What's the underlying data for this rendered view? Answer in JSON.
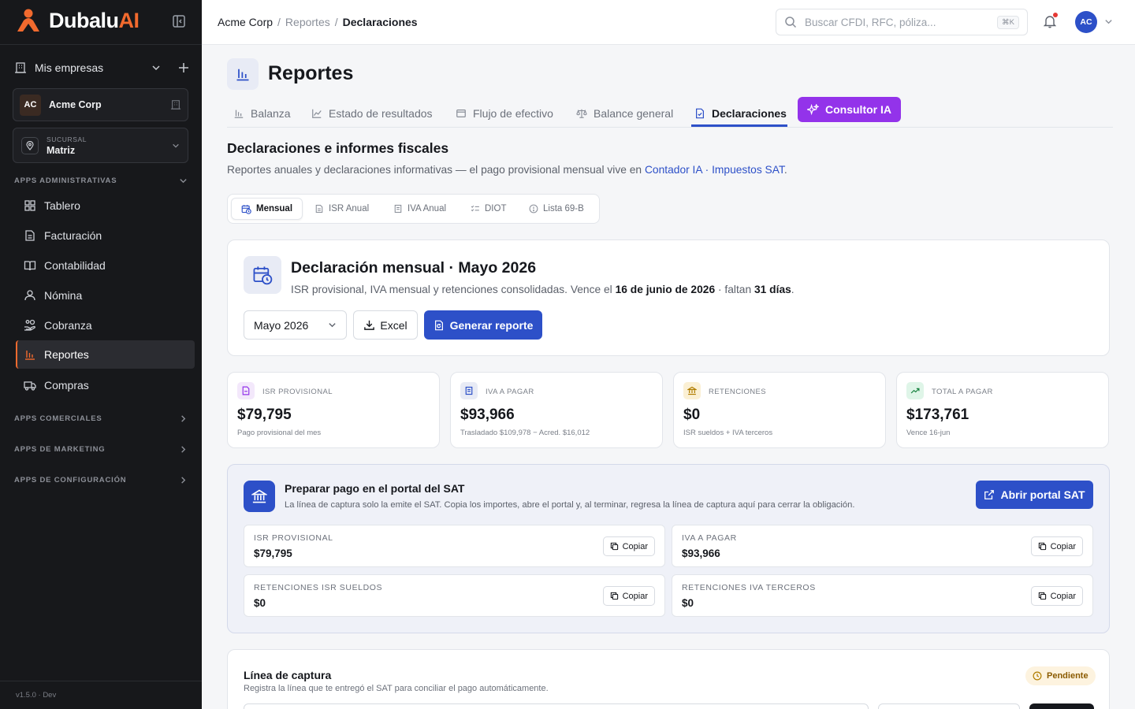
{
  "brand": {
    "name_primary": "Dubalu",
    "name_accent": "AI"
  },
  "sidebar": {
    "mis_empresas": "Mis empresas",
    "company": {
      "initials": "AC",
      "name": "Acme Corp"
    },
    "sucursal": {
      "label": "SUCURSAL",
      "value": "Matriz"
    },
    "sections": {
      "admin": "APPS ADMINISTRATIVAS",
      "comerciales": "APPS COMERCIALES",
      "marketing": "APPS DE MARKETING",
      "config": "APPS DE CONFIGURACIÓN"
    },
    "items": [
      {
        "label": "Tablero"
      },
      {
        "label": "Facturación"
      },
      {
        "label": "Contabilidad"
      },
      {
        "label": "Nómina"
      },
      {
        "label": "Cobranza"
      },
      {
        "label": "Reportes"
      },
      {
        "label": "Compras"
      }
    ],
    "version": "v1.5.0 · Dev"
  },
  "topbar": {
    "breadcrumb": [
      "Acme Corp",
      "Reportes",
      "Declaraciones"
    ],
    "search_placeholder": "Buscar CFDI, RFC, póliza...",
    "search_shortcut": "⌘K",
    "user_initials": "AC"
  },
  "page": {
    "title": "Reportes",
    "tabs": [
      {
        "label": "Balanza"
      },
      {
        "label": "Estado de resultados"
      },
      {
        "label": "Flujo de efectivo"
      },
      {
        "label": "Balance general"
      },
      {
        "label": "Declaraciones"
      },
      {
        "label": "Consultor IA"
      }
    ],
    "section_title": "Declaraciones e informes fiscales",
    "section_sub_pre": "Reportes anuales y declaraciones informativas — el pago provisional mensual vive en",
    "section_sub_link": "Contador IA · Impuestos SAT",
    "section_sub_post": ".",
    "subtabs": [
      {
        "label": "Mensual"
      },
      {
        "label": "ISR Anual"
      },
      {
        "label": "IVA Anual"
      },
      {
        "label": "DIOT"
      },
      {
        "label": "Lista 69-B"
      }
    ]
  },
  "declaracion": {
    "title": "Declaración mensual · Mayo 2026",
    "sub_pre": "ISR provisional, IVA mensual y retenciones consolidadas. Vence el",
    "due_date": "16 de junio de 2026",
    "sub_mid": "· faltan",
    "days_left": "31 días",
    "sub_end": ".",
    "period": "Mayo 2026",
    "excel_label": "Excel",
    "generate_label": "Generar reporte"
  },
  "stats": [
    {
      "label": "ISR PROVISIONAL",
      "value": "$79,795",
      "sub": "Pago provisional del mes"
    },
    {
      "label": "IVA A PAGAR",
      "value": "$93,966",
      "sub": "Trasladado $109,978 − Acred. $16,012"
    },
    {
      "label": "RETENCIONES",
      "value": "$0",
      "sub": "ISR sueldos + IVA terceros"
    },
    {
      "label": "TOTAL A PAGAR",
      "value": "$173,761",
      "sub": "Vence 16-jun"
    }
  ],
  "sat": {
    "title": "Preparar pago en el portal del SAT",
    "sub": "La línea de captura solo la emite el SAT. Copia los importes, abre el portal y, al terminar, regresa la línea de captura aquí para cerrar la obligación.",
    "portal_label": "Abrir portal SAT",
    "copy_label": "Copiar",
    "items": [
      {
        "label": "ISR PROVISIONAL",
        "value": "$79,795"
      },
      {
        "label": "IVA A PAGAR",
        "value": "$93,966"
      },
      {
        "label": "RETENCIONES ISR SUELDOS",
        "value": "$0"
      },
      {
        "label": "RETENCIONES IVA TERCEROS",
        "value": "$0"
      }
    ]
  },
  "linea": {
    "title": "Línea de captura",
    "sub": "Registra la línea que te entregó el SAT para conciliar el pago automáticamente.",
    "status": "Pendiente"
  },
  "colors": {
    "accent": "#2d50c8",
    "brand": "#f26a2e",
    "ai": "#9333ea",
    "sidebar": "#17181b"
  }
}
